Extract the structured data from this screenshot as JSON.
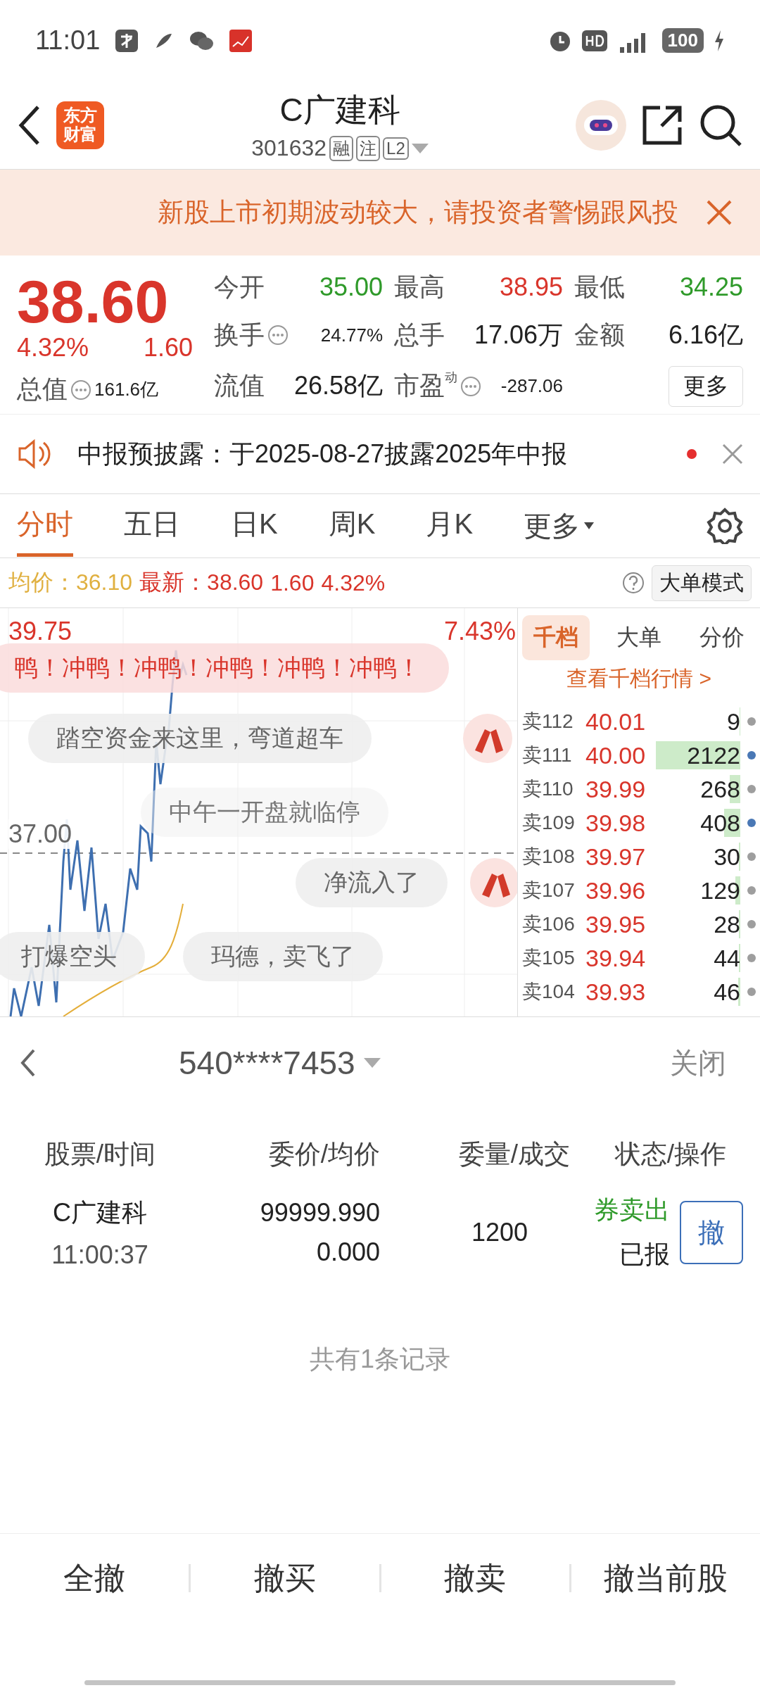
{
  "status_bar": {
    "time": "11:01",
    "battery": "100"
  },
  "header": {
    "logo_lines": [
      "东方",
      "财富"
    ],
    "title": "C广建科",
    "code": "301632",
    "tags": [
      "融",
      "注",
      "L2"
    ]
  },
  "banner": {
    "text": "新股上市初期波动较大，请投资者警惕跟风投"
  },
  "quote": {
    "price": "38.60",
    "pct": "4.32%",
    "change": "1.60",
    "stats": [
      {
        "label": "今开",
        "value": "35.00",
        "color": "#2f9a2a",
        "info": false
      },
      {
        "label": "最高",
        "value": "38.95",
        "color": "#d9352b",
        "info": false
      },
      {
        "label": "最低",
        "value": "34.25",
        "color": "#2f9a2a",
        "info": false
      },
      {
        "label": "换手",
        "value": "24.77%",
        "color": "#222222",
        "info": true
      },
      {
        "label": "总手",
        "value": "17.06万",
        "color": "#222222",
        "info": false
      },
      {
        "label": "金额",
        "value": "6.16亿",
        "color": "#222222",
        "info": false
      },
      {
        "label": "总值",
        "value": "161.6亿",
        "color": "#222222",
        "info": true
      },
      {
        "label": "流值",
        "value": "26.58亿",
        "color": "#222222",
        "info": false
      },
      {
        "label": "市盈",
        "sup": "动",
        "value": "-287.06",
        "color": "#222222",
        "info": true
      }
    ],
    "more_button": "更多"
  },
  "notice": {
    "text": "中报预披露：于2025-08-27披露2025年中报",
    "unread": true
  },
  "chart_tabs": [
    {
      "label": "分时",
      "selected": true
    },
    {
      "label": "五日",
      "selected": false
    },
    {
      "label": "日K",
      "selected": false
    },
    {
      "label": "周K",
      "selected": false
    },
    {
      "label": "月K",
      "selected": false
    }
  ],
  "chart_more": "更多",
  "info_line": {
    "avg_label": "均价：",
    "avg": "36.10",
    "latest_label": "最新：",
    "latest": "38.60",
    "change": "1.60",
    "pct": "4.32%",
    "mode_button": "大单模式"
  },
  "chart": {
    "top_price": "39.75",
    "top_pct": "7.43%",
    "ref_price": "37.00",
    "bubbles": [
      {
        "text": "鸭！冲鸭！冲鸭！冲鸭！冲鸭！冲鸭！",
        "kind": "hot"
      },
      {
        "text": "踏空资金来这里，弯道超车",
        "kind": "plain"
      },
      {
        "text": "中午一开盘就临停",
        "kind": "faint"
      },
      {
        "text": "净流入了",
        "kind": "plain"
      },
      {
        "text": "打爆空头",
        "kind": "plain"
      },
      {
        "text": "玛德，卖飞了",
        "kind": "plain"
      }
    ]
  },
  "order_book": {
    "tabs": [
      {
        "label": "千档",
        "selected": true
      },
      {
        "label": "大单",
        "selected": false
      },
      {
        "label": "分价",
        "selected": false
      }
    ],
    "link": "查看千档行情 >",
    "rows": [
      {
        "label": "卖112",
        "price": "40.01",
        "volume": "9",
        "color": "#9e9e9e"
      },
      {
        "label": "卖111",
        "price": "40.00",
        "volume": "2122",
        "color": "#4a78b5"
      },
      {
        "label": "卖110",
        "price": "39.99",
        "volume": "268",
        "color": "#9e9e9e"
      },
      {
        "label": "卖109",
        "price": "39.98",
        "volume": "408",
        "color": "#4a78b5"
      },
      {
        "label": "卖108",
        "price": "39.97",
        "volume": "30",
        "color": "#9e9e9e"
      },
      {
        "label": "卖107",
        "price": "39.96",
        "volume": "129",
        "color": "#9e9e9e"
      },
      {
        "label": "卖106",
        "price": "39.95",
        "volume": "28",
        "color": "#9e9e9e"
      },
      {
        "label": "卖105",
        "price": "39.94",
        "volume": "44",
        "color": "#9e9e9e"
      },
      {
        "label": "卖104",
        "price": "39.93",
        "volume": "46",
        "color": "#9e9e9e"
      }
    ]
  },
  "orders": {
    "account": "540****7453",
    "close": "关闭",
    "columns": [
      "股票/时间",
      "委价/均价",
      "委量/成交",
      "状态/操作"
    ],
    "rows": [
      {
        "stock": "C广建科",
        "time": "11:00:37",
        "price": "99999.990",
        "avg": "0.000",
        "qty": "1200",
        "type": "券卖出",
        "status": "已报",
        "action": "撤"
      }
    ],
    "footer": "共有1条记录"
  },
  "actions": [
    "全撤",
    "撤买",
    "撤卖",
    "撤当前股"
  ]
}
